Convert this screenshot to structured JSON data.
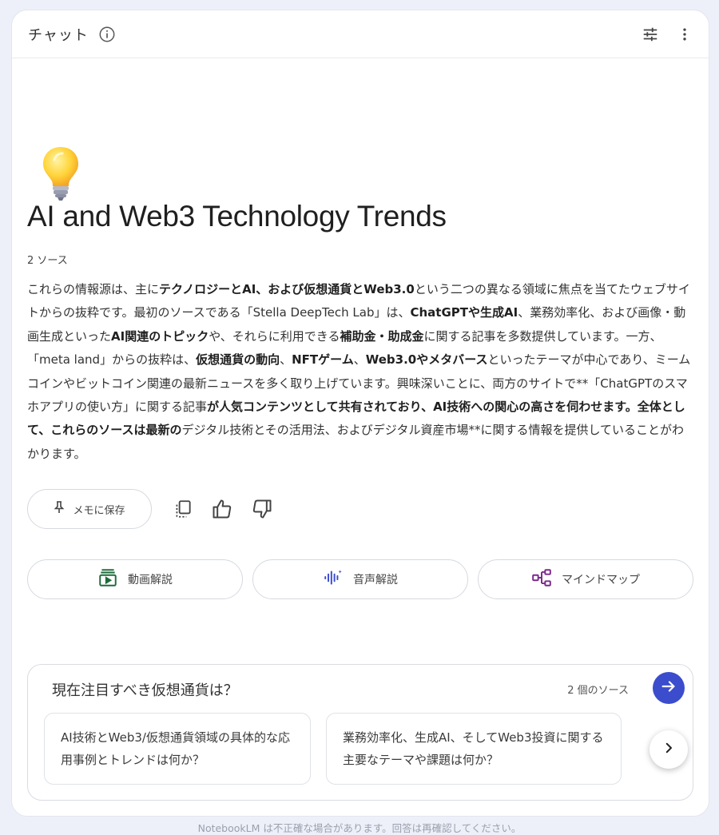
{
  "header": {
    "title": "チャット",
    "info_icon": "info-icon",
    "tune_icon": "tune-icon",
    "more_icon": "more-vert-icon"
  },
  "notebook": {
    "emoji": "💡",
    "title": "AI and Web3 Technology Trends",
    "source_count": "2 ソース",
    "summary_parts": [
      {
        "t": "これらの情報源は、主に",
        "b": false
      },
      {
        "t": "テクノロジーとAI、および仮想通貨とWeb3.0",
        "b": true
      },
      {
        "t": "という二つの異なる領域に焦点を当てたウェブサイトからの抜粋です。最初のソースである「Stella DeepTech Lab」は、",
        "b": false
      },
      {
        "t": "ChatGPTや生成AI",
        "b": true
      },
      {
        "t": "、業務効率化、および画像・動画生成といった",
        "b": false
      },
      {
        "t": "AI関連のトピック",
        "b": true
      },
      {
        "t": "や、それらに利用できる",
        "b": false
      },
      {
        "t": "補助金・助成金",
        "b": true
      },
      {
        "t": "に関する記事を多数提供しています。一方、「meta land」からの抜粋は、",
        "b": false
      },
      {
        "t": "仮想通貨の動向",
        "b": true
      },
      {
        "t": "、",
        "b": false
      },
      {
        "t": "NFTゲーム",
        "b": true
      },
      {
        "t": "、",
        "b": false
      },
      {
        "t": "Web3.0やメタバース",
        "b": true
      },
      {
        "t": "といったテーマが中心であり、ミームコインやビットコイン関連の最新ニュースを多く取り上げています。興味深いことに、両方のサイトで**「ChatGPTのスマホアプリの使い方」に関する記事",
        "b": false
      },
      {
        "t": "が人気コンテンツとして共有されており、AI技術への関心の高さを伺わせます。全体として、これらのソースは最新の",
        "b": true
      },
      {
        "t": "デジタル技術とその活用法、およびデジタル資産市場**に関する情報を提供していることがわかります。",
        "b": false
      }
    ]
  },
  "actions": {
    "save_memo_label": "メモに保存",
    "pin_icon": "pin-icon",
    "copy_icon": "copy-icon",
    "thumb_up_icon": "thumb-up-icon",
    "thumb_down_icon": "thumb-down-icon"
  },
  "studio": [
    {
      "label": "動画解説",
      "icon": "video-overview-icon",
      "color": "#1e6b3a"
    },
    {
      "label": "音声解説",
      "icon": "audio-overview-icon",
      "color": "#3b4dcc"
    },
    {
      "label": "マインドマップ",
      "icon": "mind-map-icon",
      "color": "#7b2a8c"
    }
  ],
  "composer": {
    "query": "現在注目すべき仮想通貨は？",
    "sources_label": "2 個のソース",
    "send_icon": "arrow-right-icon",
    "suggestions": [
      "AI技術とWeb3/仮想通貨領域の具体的な応用事例とトレンドは何か？",
      "業務効率化、生成AI、そしてWeb3投資に関する主要なテーマや課題は何か？"
    ],
    "next_icon": "chevron-right-icon"
  },
  "footer": {
    "note": "NotebookLM は不正確な場合があります。回答は再確認してください。"
  }
}
